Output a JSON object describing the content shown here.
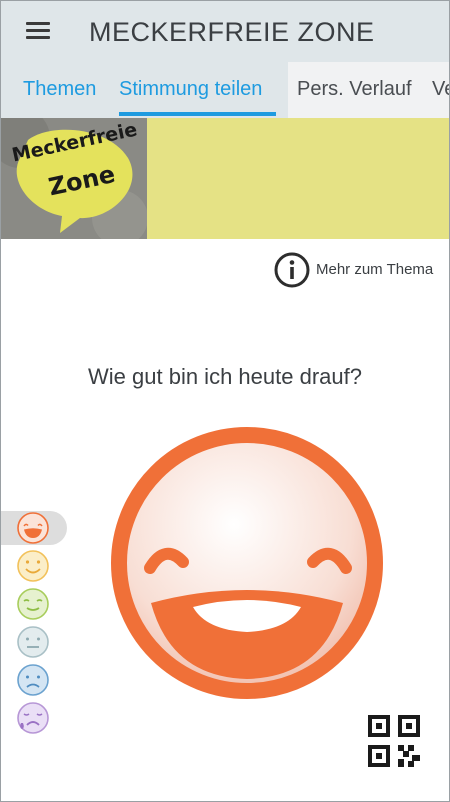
{
  "app": {
    "title": "MECKERFREIE ZONE"
  },
  "tabs": [
    {
      "label": "Themen"
    },
    {
      "label": "Stimmung teilen"
    },
    {
      "label": "Pers. Verlauf"
    },
    {
      "label": "Ve"
    }
  ],
  "banner": {
    "logo_line1": "Meckerfreie",
    "logo_line2": "Zone"
  },
  "info": {
    "label": "Mehr zum Thema"
  },
  "question": "Wie gut bin ich heute drauf?",
  "colors": {
    "accent": "#1e9be0",
    "banner": "#e5e285",
    "face_selected": "#f07038",
    "mood_1": "#f07038",
    "mood_2": "#f2c15a",
    "mood_3": "#a8cd5c",
    "mood_4": "#a9c0c6",
    "mood_5": "#6ba2cf",
    "mood_6": "#b797d6"
  },
  "moods": [
    {
      "name": "very-happy",
      "selected": true
    },
    {
      "name": "happy"
    },
    {
      "name": "content"
    },
    {
      "name": "neutral"
    },
    {
      "name": "sad"
    },
    {
      "name": "crying"
    }
  ]
}
